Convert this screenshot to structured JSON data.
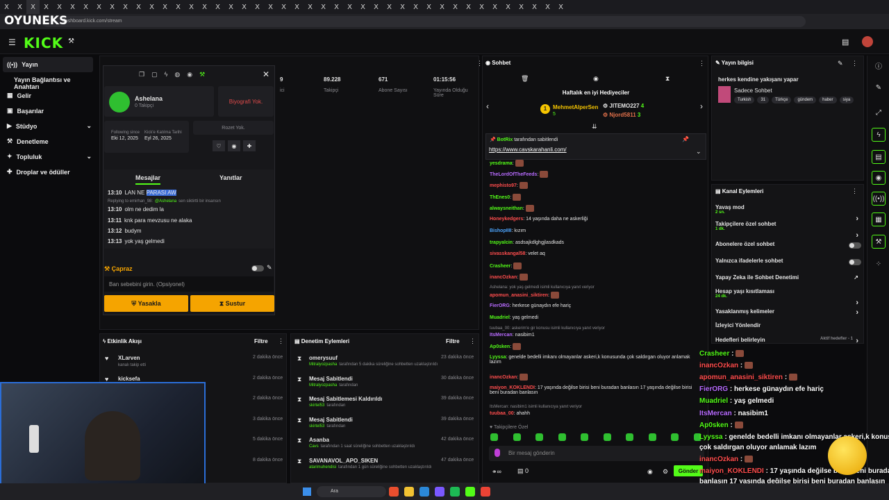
{
  "browser": {
    "url": "dashboard.kick.com/stream",
    "tab_glyph": "X"
  },
  "overlay": {
    "brand": "OYUNEKS"
  },
  "nav": {
    "logo": "KICK"
  },
  "sidebar": {
    "items": [
      {
        "label": "Yayın"
      },
      {
        "label": "Yayın Bağlantısı ve Anahtarı"
      },
      {
        "label": "Gelir"
      },
      {
        "label": "Başarılar"
      },
      {
        "label": "Stüdyo"
      },
      {
        "label": "Denetleme"
      },
      {
        "label": "Topluluk"
      },
      {
        "label": "Droplar ve ödüller"
      }
    ]
  },
  "user_card": {
    "name": "Ashelana",
    "followers": "0 Takipçi",
    "bio": "Biyografi Yok.",
    "following_since_label": "Following since",
    "following_since": "Eki 12, 2025",
    "kick_join_label": "Kick'e Katılma Tarihi",
    "kick_join": "Eyl 26, 2025",
    "badges": "Rozet Yok.",
    "tabs": [
      "Mesajlar",
      "Yanıtlar"
    ],
    "messages": [
      {
        "time": "13:10",
        "text": "LAN NE ",
        "highlight": "PARASI AW"
      },
      {
        "reply": "Replying to emirhan_98:",
        "mention": "@Ashelana",
        "reply_rest": "sen siktirtti bir insansın"
      },
      {
        "time": "13:10",
        "text": "olm ne dedim la"
      },
      {
        "time": "13:11",
        "text": "knk para mevzusu ne alaka"
      },
      {
        "time": "13:12",
        "text": "budym"
      },
      {
        "time": "13:13",
        "text": "yok yaş gelmedi"
      }
    ],
    "timeout_label": "Çapraz",
    "reason_placeholder": "Ban sebebini girin. (Opsiyonel)",
    "ban_btn": "Yasakla",
    "mute_btn": "Sustur"
  },
  "stats": [
    {
      "value": "9",
      "label": "ici"
    },
    {
      "value": "89.228",
      "label": "Takipçi"
    },
    {
      "value": "671",
      "label": "Abone Sayısı"
    },
    {
      "value": "01:15:56",
      "label": "Yayında Olduğu Süre"
    }
  ],
  "activity": {
    "title": "Etkinlik Akışı",
    "filter": "Filtre",
    "rows": [
      {
        "name": "XLarven",
        "sub": "kanalı takip etti",
        "time": "2 dakika önce"
      },
      {
        "name": "kicksefa",
        "sub": "",
        "time": "2 dakika önce"
      },
      {
        "name": "",
        "sub": "",
        "time": "2 dakika önce"
      },
      {
        "name": "",
        "sub": "",
        "time": "3 dakika önce"
      },
      {
        "name": "",
        "sub": "",
        "time": "5 dakika önce"
      },
      {
        "name": "",
        "sub": "",
        "time": "8 dakika önce"
      }
    ]
  },
  "moderation": {
    "title": "Denetim Eylemleri",
    "filter": "Filtre",
    "rows": [
      {
        "name": "omerysuuf",
        "by": "Mitralyozpasha",
        "rest": "tarafından 5 dakika süreliğine sohbetten uzaklaştırıldı",
        "time": "23 dakika önce"
      },
      {
        "name": "Mesaj Sabitlendi",
        "by": "Mitralyozpasha",
        "rest": "tarafından",
        "time": "30 dakika önce"
      },
      {
        "name": "Mesaj Sabitlemesi Kaldırıldı",
        "by": "skirtel53",
        "rest": "tarafından",
        "time": "39 dakika önce"
      },
      {
        "name": "Mesaj Sabitlendi",
        "by": "skirtel53",
        "rest": "tarafından",
        "time": "39 dakika önce"
      },
      {
        "name": "Asanba",
        "by": "Cavs",
        "rest": "tarafından 1 saat süreliğine sohbetten uzaklaştırıldı",
        "time": "42 dakika önce"
      },
      {
        "name": "SAVANAVOL_APO_SIKEN",
        "by": "atarimuhendisi",
        "rest": "tarafından 1 gün süreliğine sohbetten uzaklaştırıldı",
        "time": "47 dakika önce"
      }
    ]
  },
  "chat": {
    "title": "Sohbet",
    "gifters_title": "Haftalık en iyi Hediyeciler",
    "gifters": [
      {
        "name": "MehmetAlperSen",
        "count": "5"
      },
      {
        "name": "JITEMO227",
        "count": "4"
      },
      {
        "name": "Njord5811",
        "count": "3"
      }
    ],
    "pinned_by": "BotRix",
    "pinned_suffix": "tarafından sabitlendi",
    "pinned_link": "https://www.cavskarahanli.com/",
    "lines": [
      {
        "user": "yesdrama",
        "color": "#53fc18",
        "text": ""
      },
      {
        "user": "TheLordOfTheFeeds",
        "color": "#b86bff",
        "text": ""
      },
      {
        "user": "mephisto97",
        "color": "#ff4d4d",
        "text": ""
      },
      {
        "user": "ThEnes0",
        "color": "#53fc18",
        "text": ""
      },
      {
        "user": "alwaysneithan",
        "color": "#53fc18",
        "text": ""
      },
      {
        "user": "Honeykedgers",
        "color": "#ff4d4d",
        "text": "14 yaşında daha ne askerliği"
      },
      {
        "user": "BishopIIII",
        "color": "#4da6ff",
        "text": "kızım"
      },
      {
        "user": "trapyalcin",
        "color": "#53fc18",
        "text": "asdsajkdlghgjlasdkads"
      },
      {
        "user": "sivasskangal58",
        "color": "#ff4d4d",
        "text": "velet aq"
      },
      {
        "user": "Crasheer",
        "color": "#53fc18",
        "text": ""
      },
      {
        "user": "inancOzkan",
        "color": "#ff4d4d",
        "text": ""
      },
      {
        "reply": "Ashelana: yok yaş gelmedi isimli kullanıcıya yanıt veriyor"
      },
      {
        "user": "apomun_anasini_siktiren",
        "color": "#ff4d4d",
        "text": ""
      },
      {
        "user": "FierORG",
        "color": "#b86bff",
        "text": "herkese günaydın efe hariç"
      },
      {
        "user": "Muadriel",
        "color": "#53fc18",
        "text": "yaş gelmedi"
      },
      {
        "reply": "tuubaa_00: askerim'e gir konusu isimli kullanıcıya yanıt veriyor"
      },
      {
        "user": "ItsMercan",
        "color": "#b86bff",
        "text": "nasibim1"
      },
      {
        "user": "Ap0sken",
        "color": "#53fc18",
        "text": ""
      },
      {
        "user": "Lyyssa",
        "color": "#53fc18",
        "text": "genelde bedelli imkanı olmayanlar askeri,k konusunda çok saldırgan oluyor anlamak lazım"
      },
      {
        "user": "inancOzkan",
        "color": "#ff4d4d",
        "text": ""
      },
      {
        "user": "maiyon_KOKLENDI",
        "color": "#ff4d4d",
        "text": "17 yaşında değilse birisi beni buradan banlasın 17 yaşında değilse birisi beni buradan banlasın"
      },
      {
        "reply": "ItsMercan: nasibim1 isimli kullanıcıya yanıt veriyor"
      },
      {
        "user": "tuubaa_00",
        "color": "#ff4d4d",
        "text": "ahahh"
      }
    ],
    "followers_only": "Takipçilere Özel",
    "input_placeholder": "Bir mesaj gönderin",
    "send": "Gönder",
    "counter": "0"
  },
  "stream_info": {
    "title": "Yayın bilgisi",
    "stream_title": "herkes kendine yakışanı yapar",
    "category": "Sadece Sohbet",
    "tags": [
      "Turkish",
      "31",
      "Türkçe",
      "gündem",
      "haber",
      "siya"
    ]
  },
  "channel_actions": {
    "title": "Kanal Eylemleri",
    "rows": [
      {
        "label": "Yavaş mod",
        "sub": "2 sn."
      },
      {
        "label": "Takipçilere özel sohbet",
        "sub": "1 dk."
      },
      {
        "label": "Abonelere özel sohbet",
        "sub": ""
      },
      {
        "label": "Yalnızca ifadelerle sohbet",
        "sub": ""
      },
      {
        "label": "Yapay Zeka ile Sohbet Denetimi",
        "sub": ""
      },
      {
        "label": "Hesap yaşı kısıtlaması",
        "sub": "24 dk."
      },
      {
        "label": "Yasaklanmış kelimeler",
        "sub": ""
      },
      {
        "label": "İzleyici Yönlendir",
        "sub": ""
      },
      {
        "label": "Hedefleri belirleyin",
        "sub": "Aktif hedefler - 1"
      }
    ]
  },
  "overlay_chat": [
    {
      "user": "Crasheer",
      "color": "#53fc18",
      "text": ""
    },
    {
      "user": "inancOzkan",
      "color": "#ff4d4d",
      "text": ""
    },
    {
      "user": "apomun_anasini_siktiren",
      "color": "#ff4d4d",
      "text": ""
    },
    {
      "user": "FierORG",
      "color": "#b86bff",
      "text": "herkese günaydın efe hariç"
    },
    {
      "user": "Muadriel",
      "color": "#53fc18",
      "text": "yaş gelmedi"
    },
    {
      "user": "ItsMercan",
      "color": "#b86bff",
      "text": "nasibim1"
    },
    {
      "user": "Ap0sken",
      "color": "#53fc18",
      "text": ""
    },
    {
      "user": "Lyyssa",
      "color": "#53fc18",
      "text": "genelde bedelli imkanı olmayanlar askeri,k konusunda"
    },
    {
      "user": "",
      "color": "#fff",
      "text": "çok saldırgan oluyor anlamak lazım"
    },
    {
      "user": "inancOzkan",
      "color": "#ff4d4d",
      "text": ""
    },
    {
      "user": "maiyon_KOKLENDI",
      "color": "#ff4d4d",
      "text": "17 yaşında değilse birisi beni buradan"
    },
    {
      "user": "",
      "color": "#fff",
      "text": "banlasın 17 yaşında değilse birisi beni buradan banlasın"
    }
  ],
  "taskbar": {
    "search": "Ara"
  }
}
